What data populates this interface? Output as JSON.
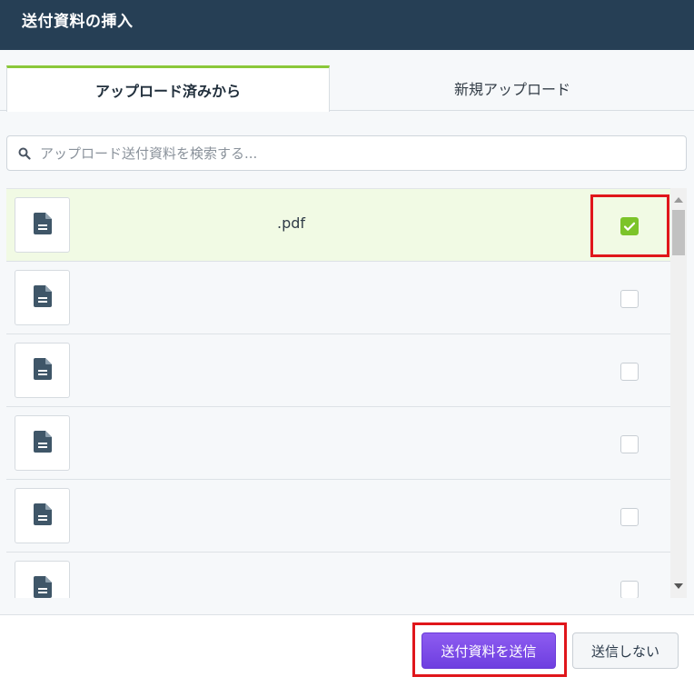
{
  "dialog": {
    "title": "送付資料の挿入"
  },
  "tabs": [
    {
      "label": "アップロード済みから",
      "active": true
    },
    {
      "label": "新規アップロード",
      "active": false
    }
  ],
  "search": {
    "placeholder": "アップロード送付資料を検索する...",
    "value": "",
    "icon": "search-icon"
  },
  "files": [
    {
      "name": ".pdf",
      "checked": true,
      "icon": "document-icon"
    },
    {
      "name": "",
      "checked": false,
      "icon": "document-icon"
    },
    {
      "name": "",
      "checked": false,
      "icon": "document-icon"
    },
    {
      "name": "",
      "checked": false,
      "icon": "document-icon"
    },
    {
      "name": "",
      "checked": false,
      "icon": "document-icon"
    },
    {
      "name": "",
      "checked": false,
      "icon": "document-icon"
    }
  ],
  "footer": {
    "send_label": "送付資料を送信",
    "cancel_label": "送信しない"
  },
  "colors": {
    "header_bg": "#263f55",
    "tab_accent": "#8bc83a",
    "selected_row_bg": "#f1fae4",
    "checkbox_checked": "#7cc42a",
    "send_button": "#7a4ae6",
    "highlight_box": "#e0161b"
  }
}
